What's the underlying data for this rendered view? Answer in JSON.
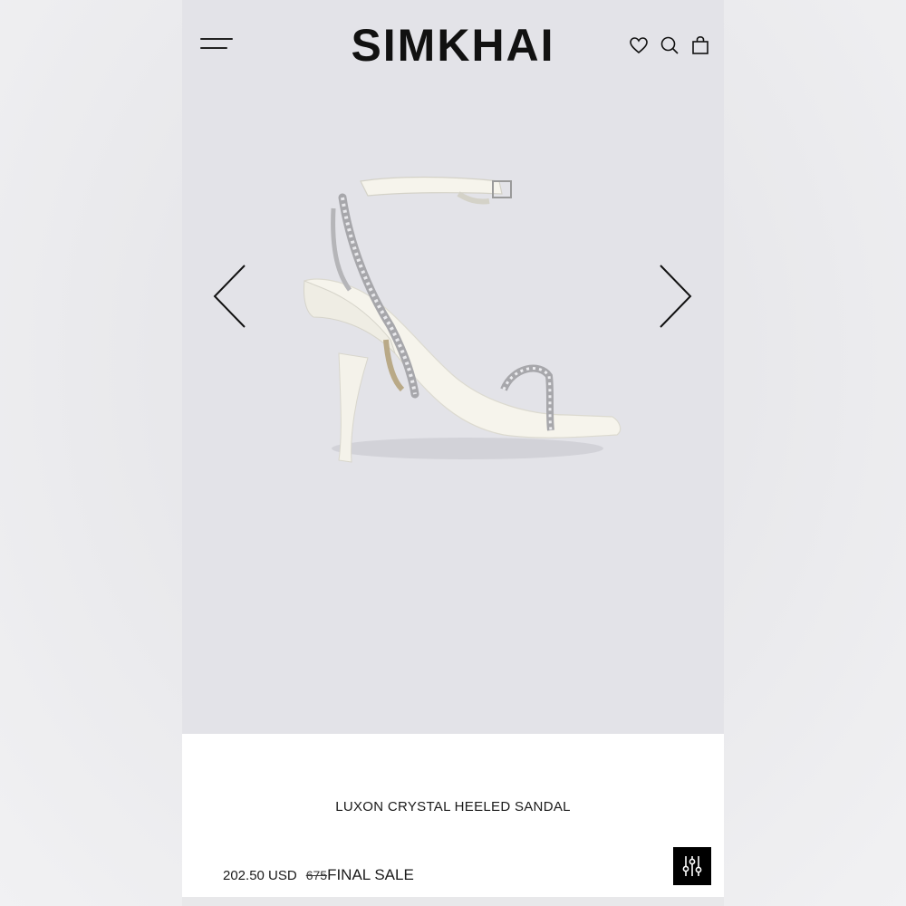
{
  "brand": {
    "logo_text": "SIMKHAI"
  },
  "header": {
    "menu_icon": "hamburger-menu-icon",
    "icons": [
      "heart-icon",
      "search-icon",
      "shopping-bag-icon"
    ]
  },
  "carousel": {
    "prev_icon": "chevron-left-icon",
    "next_icon": "chevron-right-icon",
    "image_subject": "shoe-product-image"
  },
  "product": {
    "name": "LUXON CRYSTAL HEELED SANDAL",
    "price": "202.50 USD",
    "original_price": "675",
    "sale_label": "FINAL SALE"
  },
  "filter": {
    "icon": "filter-sliders-icon"
  },
  "colors": {
    "accent": "#000000",
    "image_bg": "#e3e3e8",
    "panel_bg": "#ffffff",
    "text": "#1a1a1a"
  }
}
